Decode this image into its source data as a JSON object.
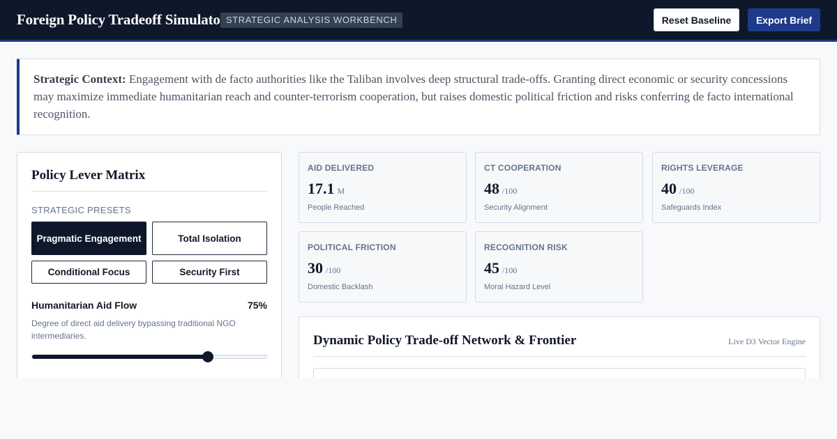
{
  "header": {
    "title": "Foreign Policy Tradeoff Simulator",
    "badge": "STRATEGIC ANALYSIS WORKBENCH",
    "reset_label": "Reset Baseline",
    "export_label": "Export Brief"
  },
  "context": {
    "label": "Strategic Context:",
    "text": "Engagement with de facto authorities like the Taliban involves deep structural trade-offs. Granting direct economic or security concessions may maximize immediate humanitarian reach and counter-terrorism cooperation, but raises domestic political friction and risks conferring de facto international recognition."
  },
  "levers": {
    "title": "Policy Lever Matrix",
    "presets_label": "STRATEGIC PRESETS",
    "presets": [
      {
        "label": "Pragmatic Engagement",
        "active": true
      },
      {
        "label": "Total Isolation",
        "active": false
      },
      {
        "label": "Conditional Focus",
        "active": false
      },
      {
        "label": "Security First",
        "active": false
      }
    ],
    "slider": {
      "name": "Humanitarian Aid Flow",
      "value_label": "75%",
      "value": 0.75,
      "description": "Degree of direct aid delivery bypassing traditional NGO intermediaries."
    }
  },
  "metrics": [
    {
      "label": "AID DELIVERED",
      "value": "17.1",
      "unit": "M",
      "sub": "People Reached"
    },
    {
      "label": "CT COOPERATION",
      "value": "48",
      "unit": "/100",
      "sub": "Security Alignment"
    },
    {
      "label": "RIGHTS LEVERAGE",
      "value": "40",
      "unit": "/100",
      "sub": "Safeguards Index"
    },
    {
      "label": "POLITICAL FRICTION",
      "value": "30",
      "unit": "/100",
      "sub": "Domestic Backlash"
    },
    {
      "label": "RECOGNITION RISK",
      "value": "45",
      "unit": "/100",
      "sub": "Moral Hazard Level"
    }
  ],
  "network": {
    "title": "Dynamic Policy Trade-off Network & Frontier",
    "tag": "Live D3 Vector Engine"
  },
  "colors": {
    "header_bg": "#0f172a",
    "accent": "#1e3a8a",
    "page_bg": "#f8f9fb"
  }
}
